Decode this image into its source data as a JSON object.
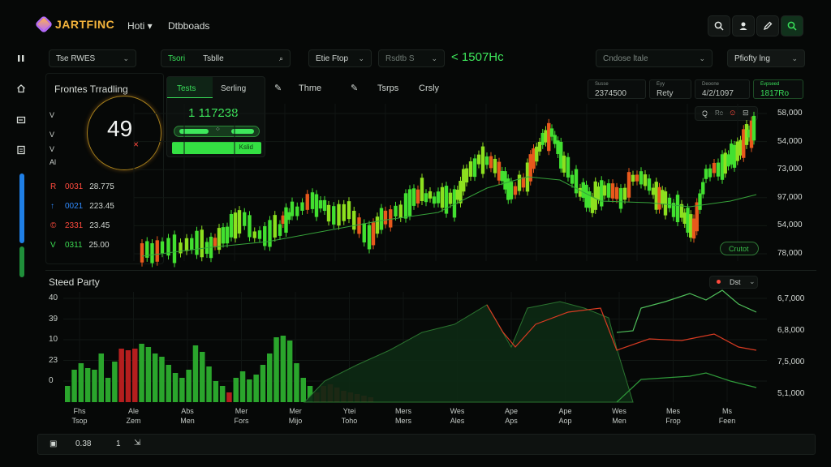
{
  "app": {
    "logo_text": "JARTFINC"
  },
  "nav": {
    "items": [
      "Hoti ▾",
      "Dtbboads"
    ]
  },
  "toolbar_icons": [
    "search-icon",
    "user-icon",
    "edit-icon",
    "search-icon"
  ],
  "controls": {
    "symbol_select": "Tse RWES",
    "tf_tab_active": "Tsori",
    "tf_tab": "Tsblle",
    "filter_select": "Etie Ftop",
    "mode_select": "Rsdtb S",
    "price_change": "< 1507Hc",
    "chart_type_select": "Cndose ltale",
    "profile_select": "Pfiofty lng"
  },
  "left_panel": {
    "title": "Frontes Trradling",
    "gauge_value": "49",
    "gauge_mark": "×",
    "rows": [
      {
        "icon": "R",
        "label": "0031",
        "value": "28.775",
        "color": "#ff4a3d"
      },
      {
        "icon": "↑",
        "label": "0021",
        "value": "223.45",
        "color": "#2f8bff"
      },
      {
        "icon": "©",
        "label": "2331",
        "value": "23.45",
        "color": "#ff4a3d"
      },
      {
        "icon": "V",
        "label": "0311",
        "value": "25.00",
        "color": "#3bdc52"
      }
    ],
    "side_letters": [
      "V",
      "V",
      "V",
      "Al"
    ]
  },
  "trade_panel": {
    "tab_active": "Tests",
    "tab": "Serling",
    "price": "1 117238",
    "action_label": "Kslid"
  },
  "tools": [
    "Thme",
    "Tsrps",
    "Crsly"
  ],
  "stats": [
    {
      "label": "Susse",
      "value": "2374500"
    },
    {
      "label": "Eyy",
      "value": "Rety"
    },
    {
      "label": "Deoone",
      "value": "4/2/1097"
    },
    {
      "label": "Evpseed",
      "value": "1817Ro"
    }
  ],
  "main_chart": {
    "legend": "Crutot",
    "y_ticks": [
      "58,000",
      "54,000",
      "73,000",
      "97,000",
      "54,000",
      "78,000"
    ],
    "mini_controls": [
      "Q",
      "Re",
      "⊙",
      "⊟"
    ]
  },
  "lower_chart": {
    "title": "Steed Party",
    "toggle": "Dst",
    "y_left": [
      "40",
      "39",
      "10",
      "23",
      "0"
    ],
    "y_right": [
      "6,7,000",
      "6,8,000",
      "7,5,000",
      "5,1,000"
    ],
    "x_labels": [
      [
        "Fhs",
        "Tsop"
      ],
      [
        "Ale",
        "Zem"
      ],
      [
        "Abs",
        "Men"
      ],
      [
        "Mer",
        "Fors"
      ],
      [
        "Mer",
        "Mijo"
      ],
      [
        "Ytei",
        "Toho"
      ],
      [
        "Mers",
        "Mers"
      ],
      [
        "Wes",
        "Ales"
      ],
      [
        "Ape",
        "Aps"
      ],
      [
        "Ape",
        "Aop"
      ],
      [
        "Wes",
        "Men"
      ],
      [
        "Mes",
        "Frop"
      ],
      [
        "Ms",
        "Feen"
      ]
    ]
  },
  "bottom": {
    "zoom": "0.38",
    "page": "1",
    "nav": "⇲"
  },
  "colors": {
    "bull": "#42e030",
    "bull_dim": "#2aa52c",
    "bear": "#e8591c",
    "line": "#36a23a",
    "accent": "#39e05a",
    "red_line": "#d93b22"
  }
}
